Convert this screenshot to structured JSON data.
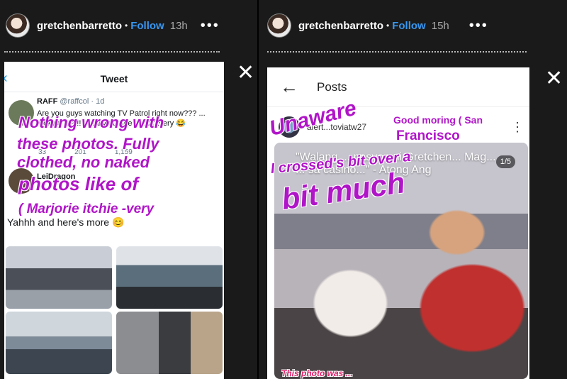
{
  "left_story": {
    "username": "gretchenbarretto",
    "separator": "•",
    "follow": "Follow",
    "time": "13h",
    "more": "•••",
    "close": "✕",
    "tweet": {
      "title": "Tweet",
      "back": "‹",
      "author_name": "RAFF",
      "author_handle": "@raffcol · 1d",
      "text": "Are you guys watching TV Patrol right now??? ... fucking tea!!! I really admire her bravery 😂",
      "stats": [
        "33",
        "201",
        "1,159"
      ],
      "reply_name": "LeiDragon",
      "more_line": "Yahhh and here's more 😊"
    },
    "overlay_lines": [
      "Nothing wrong with",
      "these photos. Fully",
      "clothed, no naked",
      "photos like of",
      "( Marjorie itchie -very"
    ]
  },
  "right_story": {
    "username": "gretchenbarretto",
    "separator": "•",
    "follow": "Follow",
    "time": "15h",
    "more": "•••",
    "close": "✕",
    "post": {
      "back": "←",
      "title": "Posts",
      "user": "alert...toviatw27",
      "dots": "⋮",
      "counter": "1/5",
      "quote": "\"Walang ... pasyon ni Gretchen... Mag... ... sa casino...\" - Atong Ang"
    },
    "overlay": {
      "unaware": "Unaware",
      "good_morning": "Good moring ( San",
      "francisco": "Francisco",
      "crossed": "I crossed's bit over a",
      "bit_much": "bit much",
      "bottom": "This photo was ..."
    }
  }
}
